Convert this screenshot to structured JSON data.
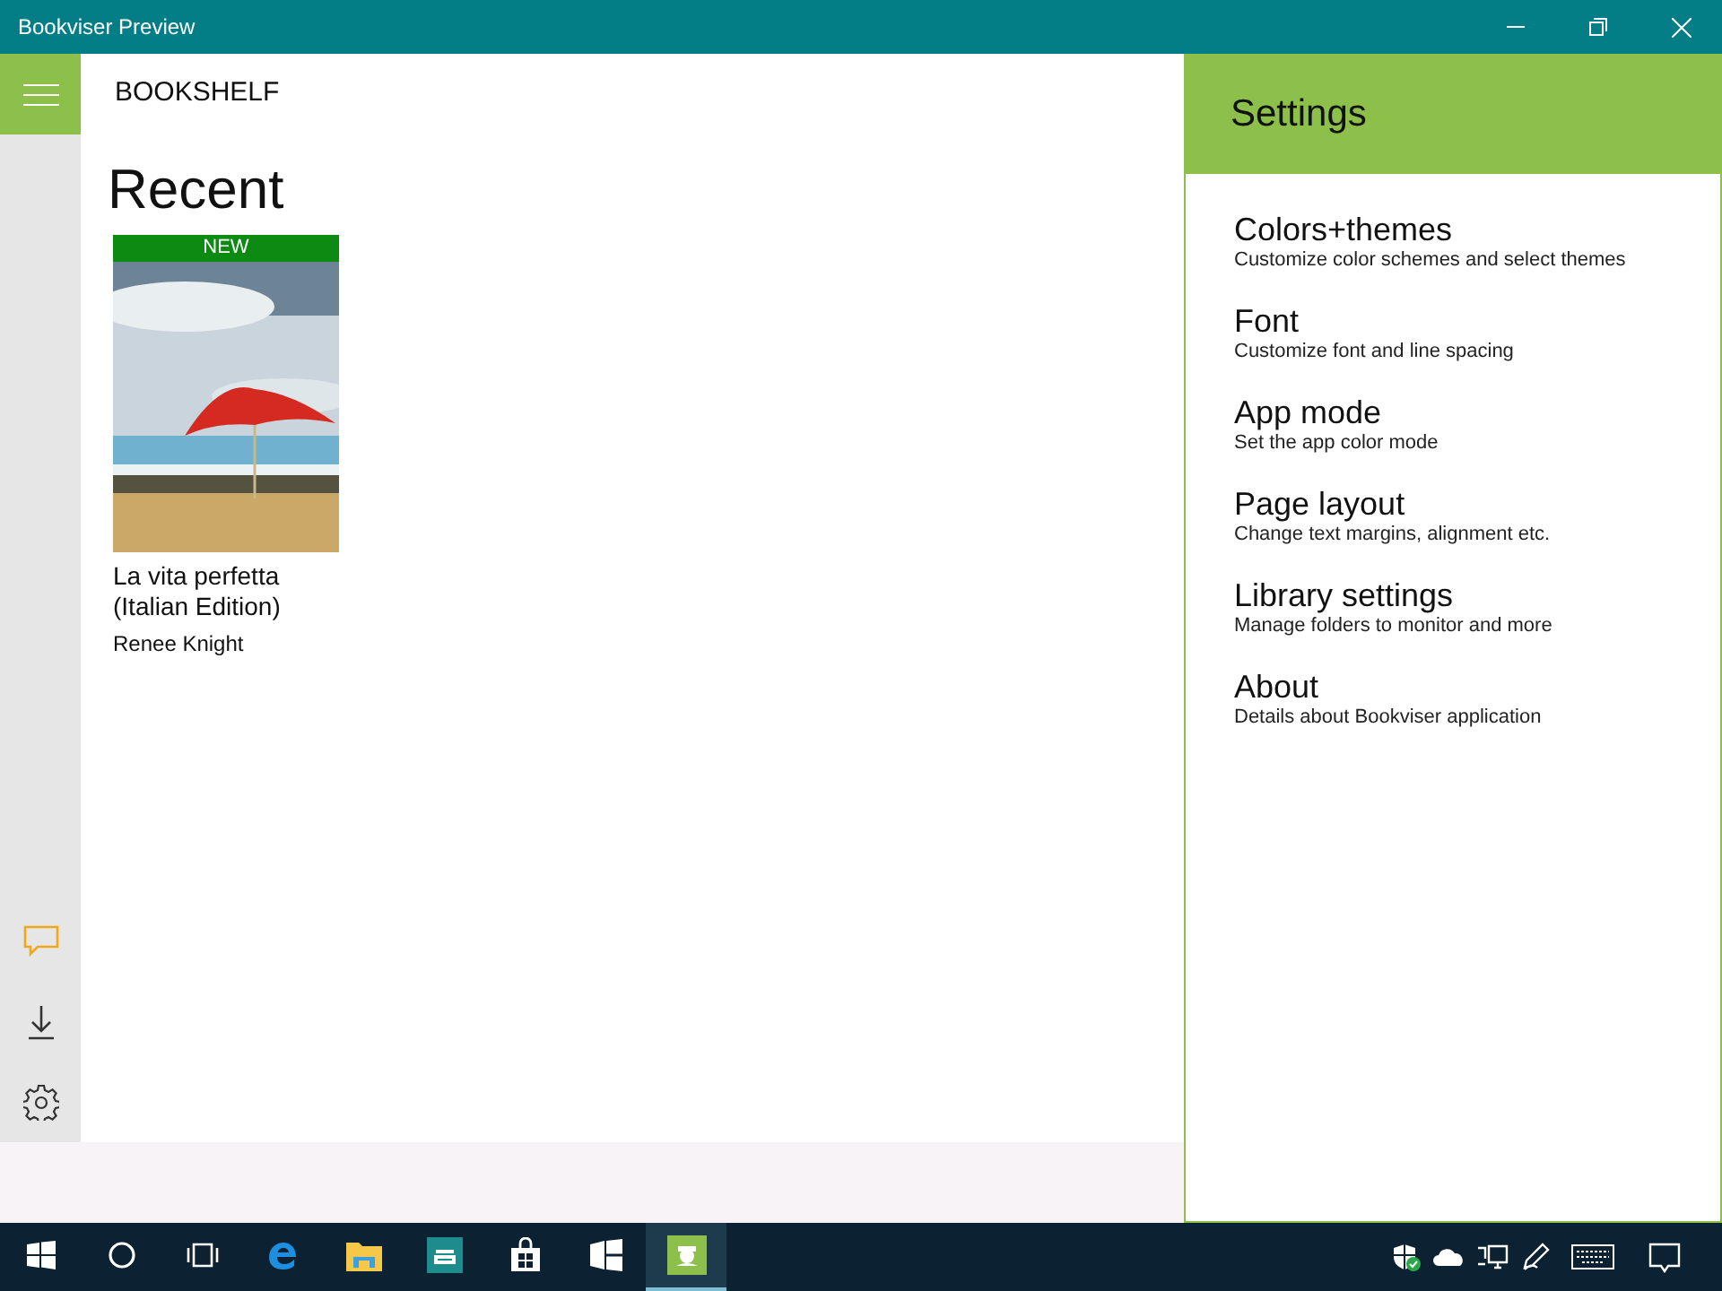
{
  "window": {
    "title": "Bookviser Preview"
  },
  "header": {
    "title": "BOOKSHELF"
  },
  "section": {
    "title": "Recent"
  },
  "books": [
    {
      "badge": "NEW",
      "title": "La vita perfetta (Italian Edition)",
      "author": "Renee Knight"
    }
  ],
  "rail": [
    {
      "kind": "feedback",
      "highlighted": true
    },
    {
      "kind": "download",
      "highlighted": false
    },
    {
      "kind": "settings",
      "highlighted": false
    }
  ],
  "settings": {
    "title": "Settings",
    "items": [
      {
        "title": "Colors+themes",
        "description": "Customize color schemes and select themes"
      },
      {
        "title": "Font",
        "description": "Customize font and line spacing"
      },
      {
        "title": "App mode",
        "description": "Set the app color mode"
      },
      {
        "title": "Page layout",
        "description": "Change text margins, alignment etc."
      },
      {
        "title": "Library settings",
        "description": "Manage folders to monitor and more"
      },
      {
        "title": "About",
        "description": "Details about Bookviser application"
      }
    ]
  },
  "taskbar": {
    "apps": [
      {
        "kind": "start",
        "selected": false
      },
      {
        "kind": "search",
        "selected": false
      },
      {
        "kind": "taskview",
        "selected": false
      },
      {
        "kind": "browser",
        "selected": false
      },
      {
        "kind": "folder",
        "selected": false
      },
      {
        "kind": "printer",
        "selected": false
      },
      {
        "kind": "store",
        "selected": false
      },
      {
        "kind": "tiles",
        "selected": false
      },
      {
        "kind": "bookviser",
        "selected": true
      }
    ],
    "tray": [
      {
        "kind": "shield"
      },
      {
        "kind": "cloud"
      },
      {
        "kind": "network"
      },
      {
        "kind": "pen"
      },
      {
        "kind": "keyboard"
      },
      {
        "kind": "notifications"
      }
    ]
  }
}
